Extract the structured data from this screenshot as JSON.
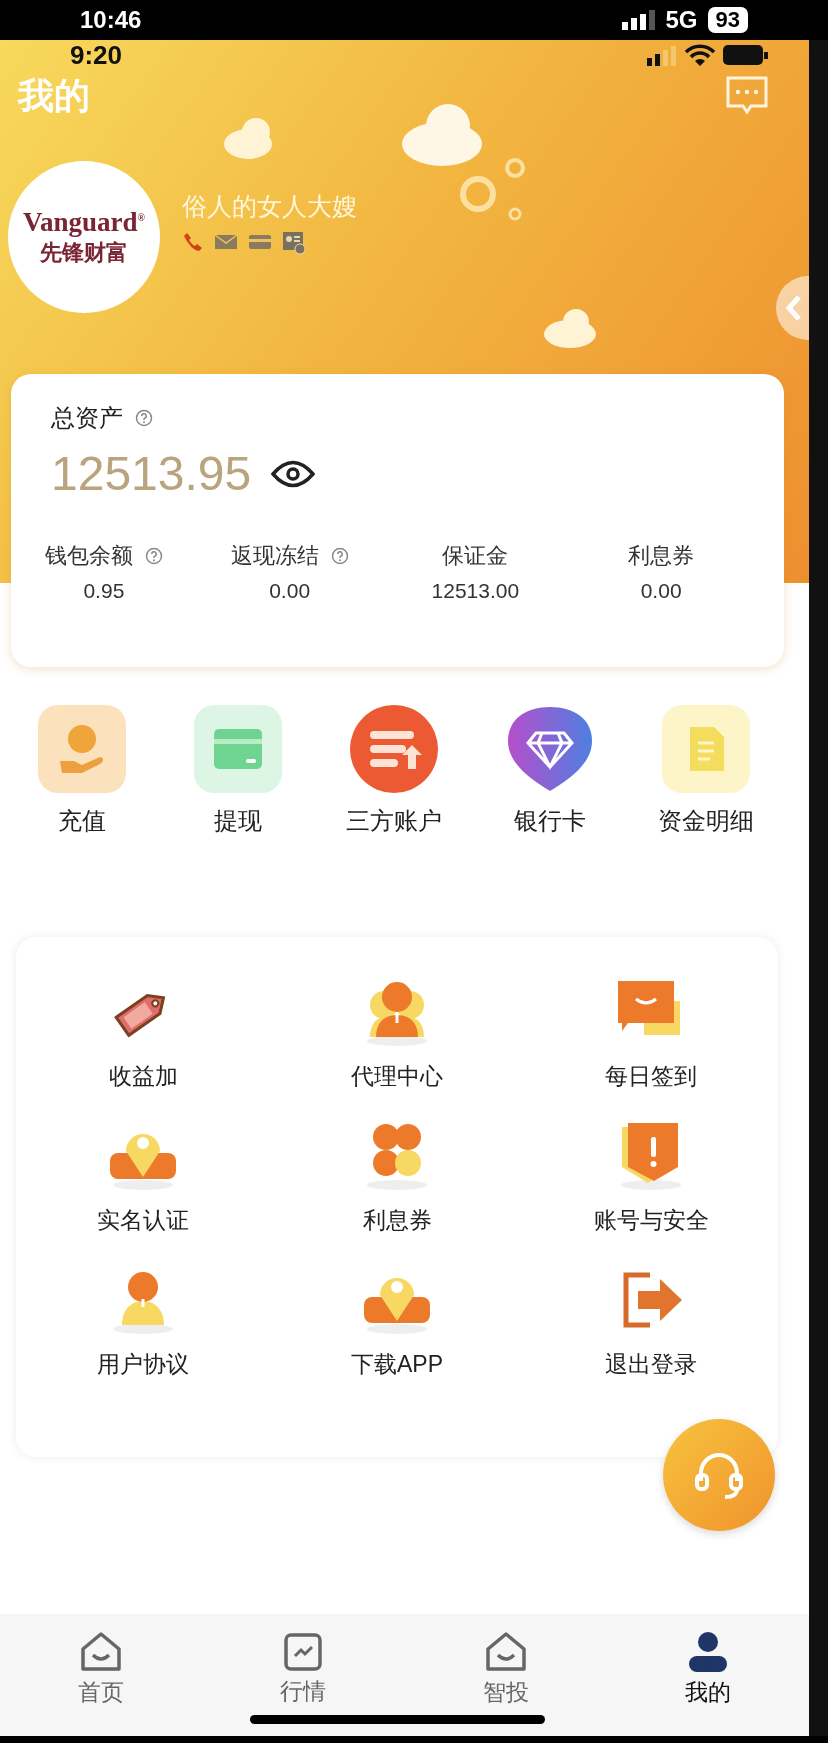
{
  "outer_status_bar": {
    "time": "10:46",
    "network": "5G",
    "battery": "93"
  },
  "status_bar": {
    "time": "9:20"
  },
  "header": {
    "title": "我的"
  },
  "profile": {
    "logo_text": "Vanguard",
    "logo_mark": "®",
    "logo_subtitle": "先锋财富",
    "name": "俗人的女人大嫂"
  },
  "assets": {
    "label": "总资产",
    "total": "12513.95",
    "items": [
      {
        "label": "钱包余额",
        "value": "0.95",
        "help": true
      },
      {
        "label": "返现冻结",
        "value": "0.00",
        "help": true
      },
      {
        "label": "保证金",
        "value": "12513.00",
        "help": false
      },
      {
        "label": "利息券",
        "value": "0.00",
        "help": false
      }
    ]
  },
  "quick_actions": [
    {
      "label": "充值",
      "kind": "coin"
    },
    {
      "label": "提现",
      "kind": "card"
    },
    {
      "label": "三方账户",
      "kind": "transfer"
    },
    {
      "label": "银行卡",
      "kind": "diamond"
    },
    {
      "label": "资金明细",
      "kind": "document"
    }
  ],
  "services": [
    {
      "label": "收益加",
      "kind": "tag"
    },
    {
      "label": "代理中心",
      "kind": "agent"
    },
    {
      "label": "每日签到",
      "kind": "chat"
    },
    {
      "label": "实名认证",
      "kind": "pin"
    },
    {
      "label": "利息券",
      "kind": "clover"
    },
    {
      "label": "账号与安全",
      "kind": "shield"
    },
    {
      "label": "用户协议",
      "kind": "user"
    },
    {
      "label": "下载APP",
      "kind": "pin"
    },
    {
      "label": "退出登录",
      "kind": "logout"
    }
  ],
  "tabs": [
    {
      "label": "首页",
      "kind": "home",
      "selected": false
    },
    {
      "label": "行情",
      "kind": "chart",
      "selected": false
    },
    {
      "label": "智投",
      "kind": "home",
      "selected": false
    },
    {
      "label": "我的",
      "kind": "person",
      "selected": true
    }
  ]
}
